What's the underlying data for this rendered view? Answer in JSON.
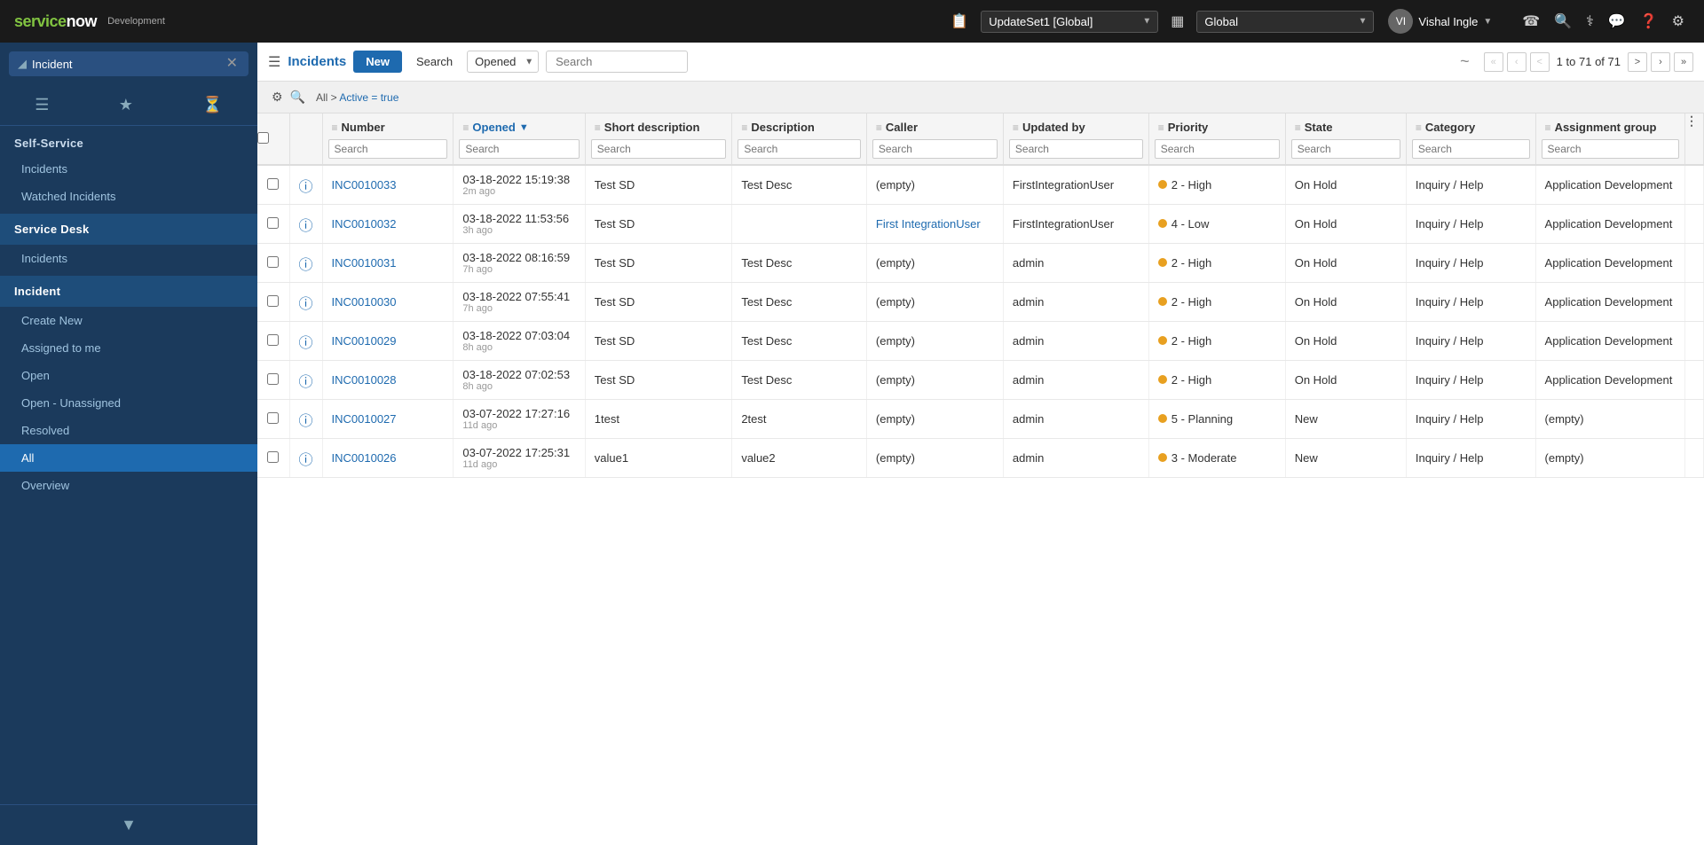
{
  "app": {
    "logo": "servicenow",
    "env": "Development"
  },
  "topbar": {
    "updateset_label": "UpdateSet1 [Global]",
    "scope_label": "Global",
    "user_name": "Vishal Ingle",
    "icons": [
      "phone-icon",
      "search-icon",
      "accessibility-icon",
      "chat-icon",
      "help-icon",
      "settings-icon"
    ]
  },
  "sidebar": {
    "search_placeholder": "Incident",
    "icon_tabs": [
      "document-icon",
      "star-icon",
      "history-icon"
    ],
    "sections": [
      {
        "header": "Self-Service",
        "items": [
          "Incidents",
          "Watched Incidents"
        ]
      },
      {
        "header": "Service Desk",
        "items": [
          "Incidents"
        ]
      },
      {
        "header": "Incident",
        "items": [
          "Create New",
          "Assigned to me",
          "Open",
          "Open - Unassigned",
          "Resolved",
          "All",
          "Overview"
        ]
      }
    ],
    "active_item": "All"
  },
  "list": {
    "title": "Incidents",
    "new_btn": "New",
    "search_btn": "Search",
    "filter_select": "Opened",
    "search_placeholder": "Search",
    "pagination": {
      "current": "1",
      "total_pages": "71",
      "total_records": "71"
    },
    "filter_breadcrumb": "All > Active = true",
    "columns": [
      {
        "id": "number",
        "label": "Number",
        "sortable": false
      },
      {
        "id": "opened",
        "label": "Opened",
        "sortable": true
      },
      {
        "id": "short_description",
        "label": "Short description",
        "sortable": false
      },
      {
        "id": "description",
        "label": "Description",
        "sortable": false
      },
      {
        "id": "caller",
        "label": "Caller",
        "sortable": false
      },
      {
        "id": "updated_by",
        "label": "Updated by",
        "sortable": false
      },
      {
        "id": "priority",
        "label": "Priority",
        "sortable": false
      },
      {
        "id": "state",
        "label": "State",
        "sortable": false
      },
      {
        "id": "category",
        "label": "Category",
        "sortable": false
      },
      {
        "id": "assignment_group",
        "label": "Assignment group",
        "sortable": false
      }
    ],
    "rows": [
      {
        "number": "INC0010033",
        "opened": "03-18-2022 15:19:38",
        "time_ago": "2m ago",
        "short_description": "Test SD",
        "description": "Test Desc",
        "caller": "(empty)",
        "updated_by": "FirstIntegrationUser",
        "priority": "2 - High",
        "priority_level": "high",
        "state": "On Hold",
        "category": "Inquiry / Help",
        "assignment_group": "Application Development"
      },
      {
        "number": "INC0010032",
        "opened": "03-18-2022 11:53:56",
        "time_ago": "3h ago",
        "short_description": "Test SD",
        "description": "",
        "caller": "First IntegrationUser",
        "caller_link": true,
        "updated_by": "FirstIntegrationUser",
        "priority": "4 - Low",
        "priority_level": "low",
        "state": "On Hold",
        "category": "Inquiry / Help",
        "assignment_group": "Application Development"
      },
      {
        "number": "INC0010031",
        "opened": "03-18-2022 08:16:59",
        "time_ago": "7h ago",
        "short_description": "Test SD",
        "description": "Test Desc",
        "caller": "(empty)",
        "updated_by": "admin",
        "priority": "2 - High",
        "priority_level": "high",
        "state": "On Hold",
        "category": "Inquiry / Help",
        "assignment_group": "Application Development"
      },
      {
        "number": "INC0010030",
        "opened": "03-18-2022 07:55:41",
        "time_ago": "7h ago",
        "short_description": "Test SD",
        "description": "Test Desc",
        "caller": "(empty)",
        "updated_by": "admin",
        "priority": "2 - High",
        "priority_level": "high",
        "state": "On Hold",
        "category": "Inquiry / Help",
        "assignment_group": "Application Development"
      },
      {
        "number": "INC0010029",
        "opened": "03-18-2022 07:03:04",
        "time_ago": "8h ago",
        "short_description": "Test SD",
        "description": "Test Desc",
        "caller": "(empty)",
        "updated_by": "admin",
        "priority": "2 - High",
        "priority_level": "high",
        "state": "On Hold",
        "category": "Inquiry / Help",
        "assignment_group": "Application Development"
      },
      {
        "number": "INC0010028",
        "opened": "03-18-2022 07:02:53",
        "time_ago": "8h ago",
        "short_description": "Test SD",
        "description": "Test Desc",
        "caller": "(empty)",
        "updated_by": "admin",
        "priority": "2 - High",
        "priority_level": "high",
        "state": "On Hold",
        "category": "Inquiry / Help",
        "assignment_group": "Application Development"
      },
      {
        "number": "INC0010027",
        "opened": "03-07-2022 17:27:16",
        "time_ago": "11d ago",
        "short_description": "1test",
        "description": "2test",
        "caller": "(empty)",
        "updated_by": "admin",
        "priority": "5 - Planning",
        "priority_level": "planning",
        "state": "New",
        "category": "Inquiry / Help",
        "assignment_group": "(empty)"
      },
      {
        "number": "INC0010026",
        "opened": "03-07-2022 17:25:31",
        "time_ago": "11d ago",
        "short_description": "value1",
        "description": "value2",
        "caller": "(empty)",
        "updated_by": "admin",
        "priority": "3 - Moderate",
        "priority_level": "moderate",
        "state": "New",
        "category": "Inquiry / Help",
        "assignment_group": "(empty)"
      }
    ]
  },
  "colors": {
    "brand_blue": "#1e6aaf",
    "sidebar_bg": "#1b3a5c",
    "high_priority": "#e8a020",
    "nav_active": "#1e6aaf"
  }
}
